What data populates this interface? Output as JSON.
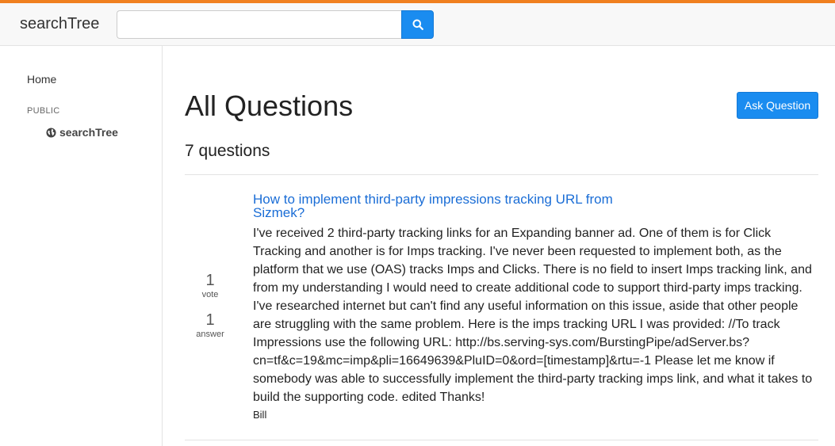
{
  "header": {
    "brand": "searchTree",
    "search": {
      "placeholder": "",
      "value": ""
    },
    "search_icon": "magnifier-icon",
    "accent_color": "#f0801f"
  },
  "sidebar": {
    "home": "Home",
    "section": "PUBLIC",
    "site": {
      "label": "searchTree",
      "icon": "globe-icon"
    }
  },
  "main": {
    "title": "All Questions",
    "ask_button": "Ask Question",
    "count": "7 questions",
    "questions": [
      {
        "votes": "1",
        "votes_label": "vote",
        "answers": "1",
        "answers_label": "answer",
        "title": "How to implement third-party impressions tracking URL from Sizmek?",
        "excerpt": "I've received 2 third-party tracking links for an Expanding banner ad. One of them is for Click Tracking and another is for Imps tracking. I've never been requested to implement both, as the platform that we use (OAS) tracks Imps and Clicks. There is no field to insert Imps tracking link, and from my understanding I would need to create additional code to support third-party imps tracking. I've researched internet but can't find any useful information on this issue, aside that other people are struggling with the same problem. Here is the imps tracking URL I was provided: //To track Impressions use the following URL: http://bs.serving-sys.com/BurstingPipe/adServer.bs?cn=tf&c=19&mc=imp&pli=16649639&PluID=0&ord=[timestamp]&rtu=-1 Please let me know if somebody was able to successfully implement the third-party tracking imps link, and what it takes to build the supporting code. edited Thanks!",
        "author": "Bill"
      }
    ]
  },
  "colors": {
    "primary": "#1a8cf0",
    "link": "#1a6dd6"
  }
}
